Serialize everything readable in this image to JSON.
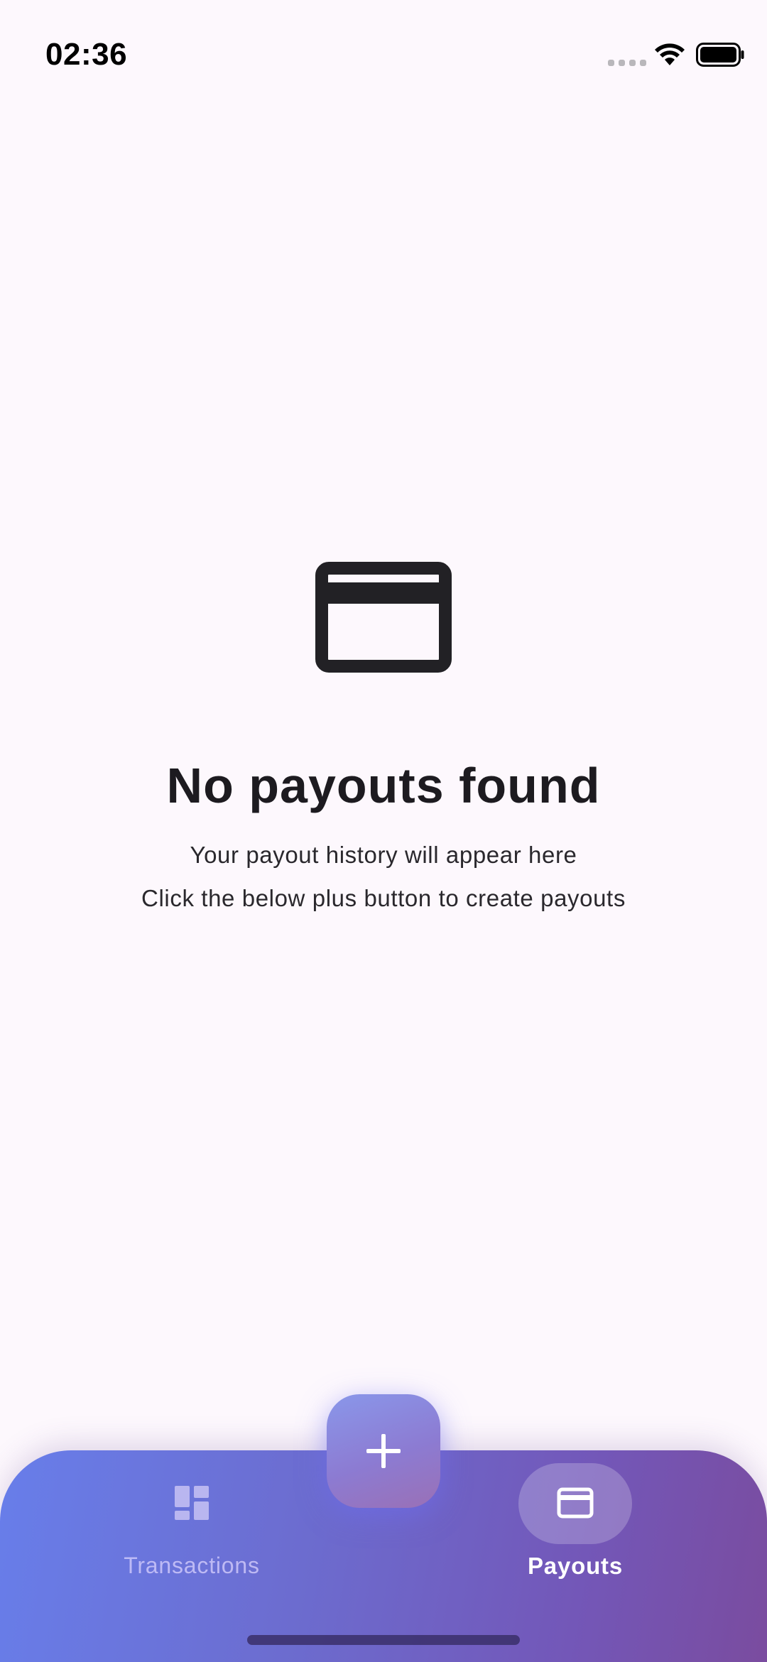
{
  "status_bar": {
    "time": "02:36"
  },
  "empty_state": {
    "icon": "credit-card-icon",
    "title": "No payouts found",
    "subtitle_line1": "Your payout history will appear here",
    "subtitle_line2": "Click the below plus button to create payouts"
  },
  "fab": {
    "icon": "plus-icon"
  },
  "bottom_nav": {
    "items": [
      {
        "label": "Transactions",
        "icon": "dashboard-icon",
        "selected": false
      },
      {
        "label": "Payouts",
        "icon": "credit-card-icon",
        "selected": true
      }
    ]
  },
  "colors": {
    "background": "#fdf8fd",
    "nav_gradient_start": "#687eea",
    "nav_gradient_end": "#7a4c9f",
    "text_primary": "#1d1b20"
  }
}
